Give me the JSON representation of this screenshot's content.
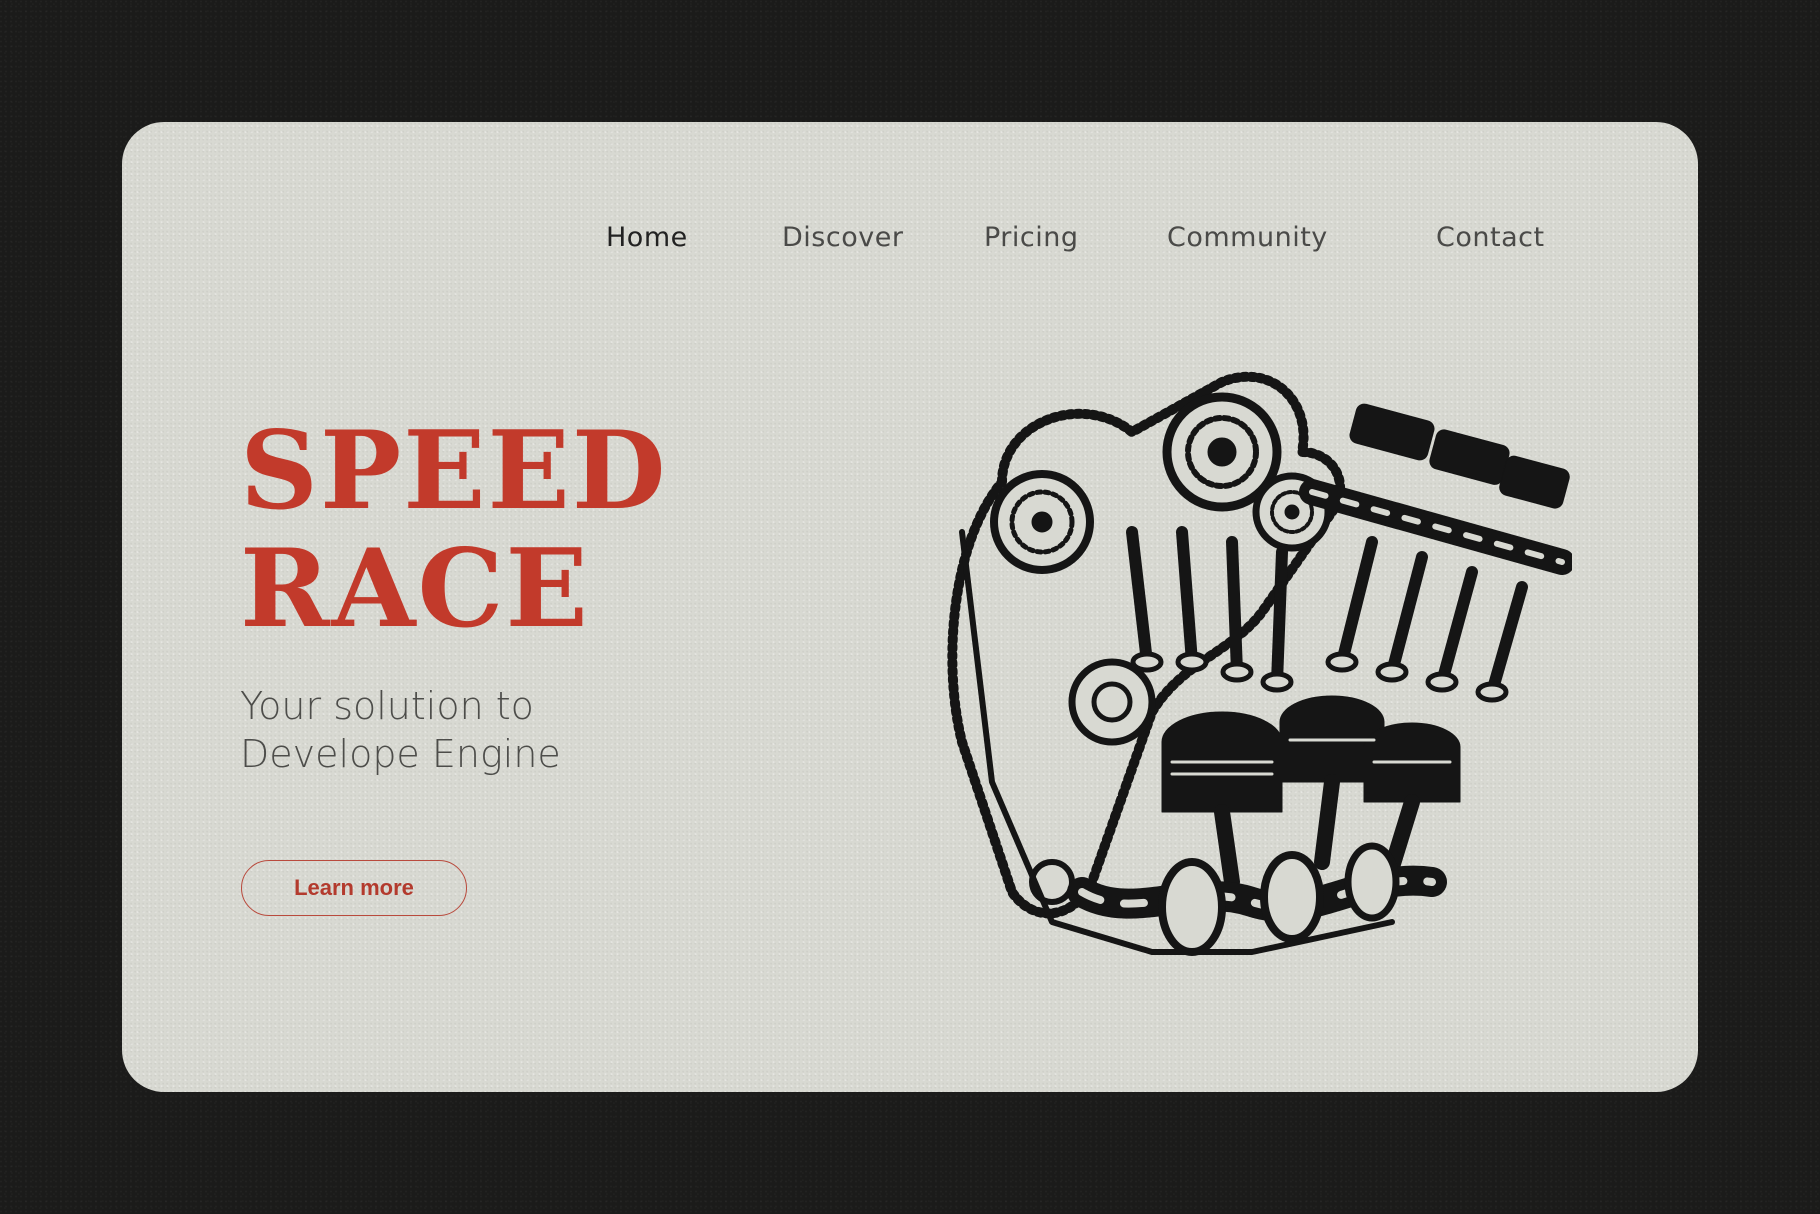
{
  "nav": {
    "items": [
      {
        "label": "Home",
        "active": true
      },
      {
        "label": "Discover",
        "active": false
      },
      {
        "label": "Pricing",
        "active": false
      },
      {
        "label": "Community",
        "active": false
      },
      {
        "label": "Contact",
        "active": false
      }
    ]
  },
  "hero": {
    "title_line1": "SPEED",
    "title_line2": "RACE",
    "subtitle_line1": "Your solution to",
    "subtitle_line2": "Develope Engine",
    "cta_label": "Learn more",
    "accent_color": "#c23a2b"
  },
  "illustration": {
    "icon": "engine-illustration"
  },
  "colors": {
    "background": "#1b1b1a",
    "card": "#d8d9d2",
    "text": "#4d4d4a",
    "accent": "#c23a2b"
  }
}
